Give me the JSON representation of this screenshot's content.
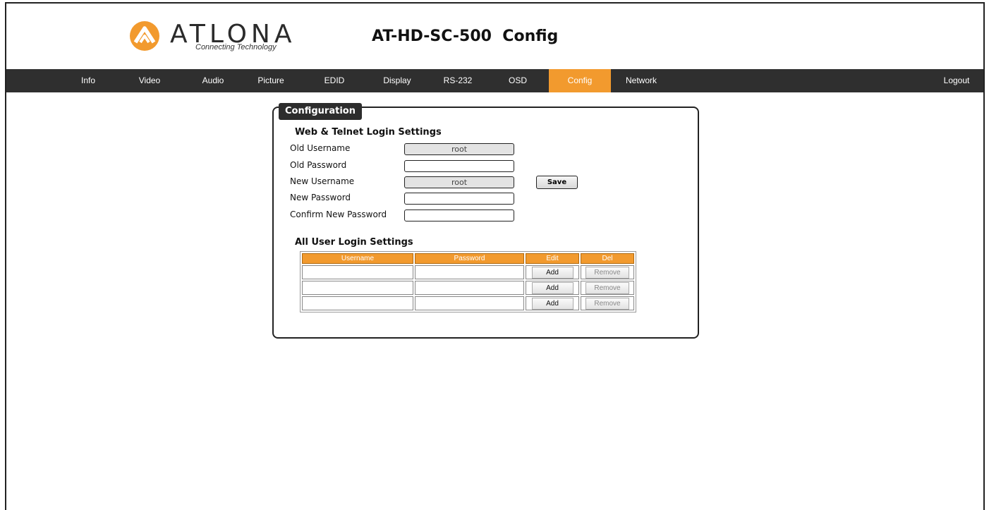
{
  "header": {
    "brand": "ATLONA",
    "tagline": "Connecting Technology",
    "device_title": "AT-HD-SC-500  Config"
  },
  "nav": {
    "items": [
      "Info",
      "Video",
      "Audio",
      "Picture",
      "EDID",
      "Display",
      "RS-232",
      "OSD",
      "Config",
      "Network"
    ],
    "active": "Config",
    "logout": "Logout"
  },
  "colors": {
    "accent": "#f29a2e",
    "nav_bg": "#2f2f2f"
  },
  "panel": {
    "title": "Configuration",
    "web_telnet": {
      "heading": "Web & Telnet Login Settings",
      "old_username_label": "Old Username",
      "old_username_value": "root",
      "old_password_label": "Old Password",
      "new_username_label": "New Username",
      "new_username_value": "root",
      "new_password_label": "New Password",
      "confirm_password_label": "Confirm New Password",
      "save_label": "Save"
    },
    "all_users": {
      "heading": "All User Login Settings",
      "columns": [
        "Username",
        "Password",
        "Edit",
        "Del"
      ],
      "rows": [
        {
          "username": "",
          "password": "",
          "edit": "Add",
          "del": "Remove"
        },
        {
          "username": "",
          "password": "",
          "edit": "Add",
          "del": "Remove"
        },
        {
          "username": "",
          "password": "",
          "edit": "Add",
          "del": "Remove"
        }
      ]
    }
  }
}
